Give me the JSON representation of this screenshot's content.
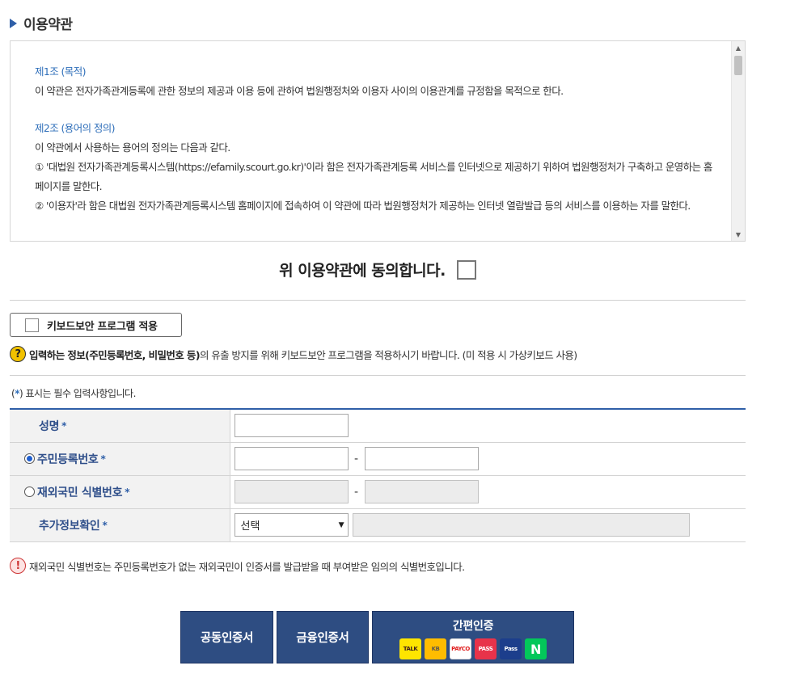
{
  "section": {
    "title": "이용약관"
  },
  "terms": {
    "article1_title": "제1조 (목적)",
    "article1_body": "이 약관은 전자가족관계등록에 관한 정보의 제공과 이용 등에 관하여 법원행정처와 이용자 사이의 이용관계를 규정함을 목적으로 한다.",
    "article2_title": "제2조 (용어의 정의)",
    "article2_intro": "이 약관에서 사용하는 용어의 정의는 다음과 같다.",
    "article2_item1": "① '대법원 전자가족관계등록시스템(https://efamily.scourt.go.kr)'이라 함은 전자가족관계등록 서비스를 인터넷으로 제공하기 위하여 법원행정처가 구축하고 운영하는 홈페이지를 말한다.",
    "article2_item2": "② '이용자'라 함은 대법원 전자가족관계등록시스템 홈페이지에 접속하여 이 약관에 따라 법원행정처가 제공하는 인터넷 열람발급 등의 서비스를 이용하는 자를 말한다."
  },
  "agree": {
    "label": "위 이용약관에 동의합니다."
  },
  "keyboard": {
    "button_label": "키보드보안 프로그램 적용",
    "notice_bold": "입력하는 정보(주민등록번호, 비밀번호 등)",
    "notice_rest": "의 유출 방지를 위해 키보드보안 프로그램을 적용하시기 바랍니다. (미 적용 시 가상키보드 사용)"
  },
  "form": {
    "required_note_prefix": "(",
    "required_note_star": "*",
    "required_note_suffix": ") 표시는 필수 입력사항입니다.",
    "name_label": "성명",
    "rrn_label": "주민등록번호",
    "foreign_label": "재외국민 식별번호",
    "extra_label": "추가정보확인",
    "star": "*",
    "dash": "-",
    "select_value": "선택",
    "rrn_selected": true
  },
  "foreign_notice": "재외국민 식별번호는 주민등록번호가 없는 재외국민이 인증서를 발급받을 때 부여받은 임의의 식별번호입니다.",
  "buttons": {
    "joint_cert": "공동인증서",
    "finance_cert": "금융인증서",
    "simple_auth": "간편인증",
    "logos": [
      {
        "icon": "kakao-talk-logo",
        "text": "TALK"
      },
      {
        "icon": "kb-logo",
        "text": "KB"
      },
      {
        "icon": "payco-logo",
        "text": "PAYCO"
      },
      {
        "icon": "pass-logo",
        "text": "PASS"
      },
      {
        "icon": "samsung-pass-logo",
        "text": "Pass"
      },
      {
        "icon": "naver-logo",
        "text": "N"
      }
    ]
  }
}
